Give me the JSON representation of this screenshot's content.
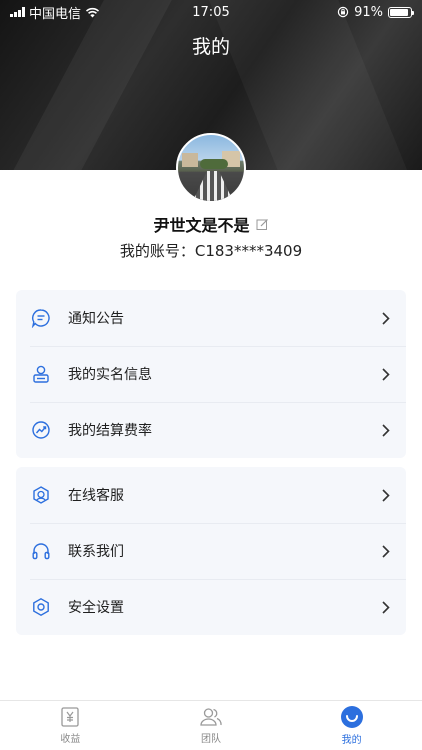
{
  "status_bar": {
    "carrier": "中国电信",
    "time": "17:05",
    "battery_percent": "91%",
    "battery_level": 0.91
  },
  "header": {
    "title": "我的"
  },
  "profile": {
    "name": "尹世文是不是",
    "account": "我的账号：C183****3409"
  },
  "menu_group_1": [
    {
      "label": "通知公告",
      "icon": "announcement-icon"
    },
    {
      "label": "我的实名信息",
      "icon": "id-badge-icon"
    },
    {
      "label": "我的结算费率",
      "icon": "rate-trend-icon"
    }
  ],
  "menu_group_2": [
    {
      "label": "在线客服",
      "icon": "customer-service-icon"
    },
    {
      "label": "联系我们",
      "icon": "headphones-icon"
    },
    {
      "label": "安全设置",
      "icon": "security-settings-icon"
    }
  ],
  "tabbar": [
    {
      "label": "收益",
      "icon": "earnings-icon",
      "active": false
    },
    {
      "label": "团队",
      "icon": "team-icon",
      "active": false
    },
    {
      "label": "我的",
      "icon": "profile-icon",
      "active": true
    }
  ],
  "colors": {
    "accent": "#2c6fde",
    "icon": "#2c6fde",
    "card_bg": "#f5f7fb"
  }
}
